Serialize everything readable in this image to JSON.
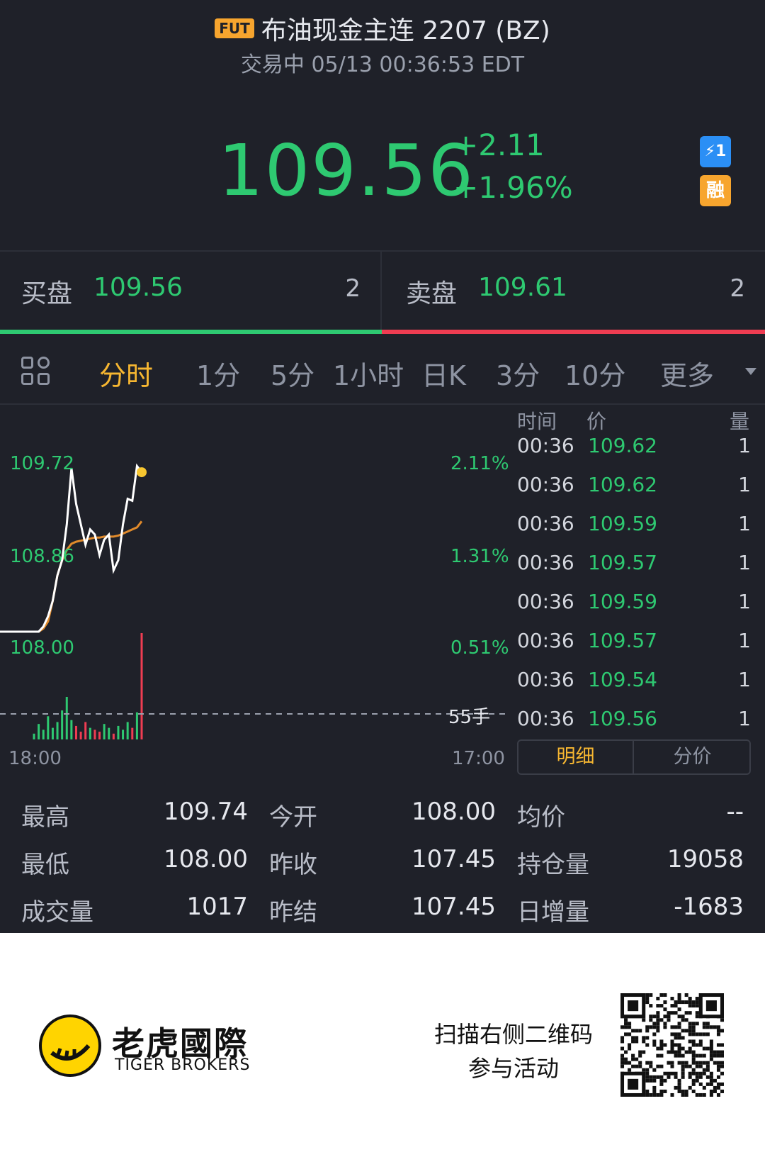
{
  "header": {
    "badge": "FUT",
    "title": "布油现金主连 2207 (BZ)",
    "status": "交易中 05/13 00:36:53 EDT"
  },
  "quote": {
    "last_price": "109.56",
    "change": "+2.11",
    "change_pct": "+1.96%",
    "badge_fast": "⚡1",
    "badge_margin": "融"
  },
  "order_book": {
    "bid_label": "买盘",
    "bid_price": "109.56",
    "bid_size": "2",
    "ask_label": "卖盘",
    "ask_price": "109.61",
    "ask_size": "2"
  },
  "tabs": [
    "分时",
    "1分",
    "5分",
    "1小时",
    "日K",
    "3分",
    "10分",
    "更多"
  ],
  "active_tab": "分时",
  "chart_labels": {
    "price_high": "109.72",
    "price_mid": "108.86",
    "price_low": "108.00",
    "pct_high": "2.11%",
    "pct_mid": "1.31%",
    "pct_low": "0.51%",
    "volume_label": "55手",
    "time_start": "18:00",
    "time_end": "17:00"
  },
  "chart_data": {
    "type": "line",
    "series": [
      {
        "values": [
          108.0,
          108.0,
          108.05,
          108.15,
          108.3,
          108.55,
          108.7,
          109.05,
          109.6,
          109.25,
          109.05,
          108.85,
          109.0,
          108.95,
          108.75,
          108.9,
          108.95,
          108.6,
          108.7,
          109.05,
          109.3,
          109.28,
          109.62,
          109.56
        ]
      },
      {
        "values": [
          108.0,
          108.0,
          108.03,
          108.1,
          108.3,
          108.55,
          108.7,
          108.8,
          108.86,
          108.88,
          108.89,
          108.9,
          108.91,
          108.92,
          108.92,
          108.93,
          108.93,
          108.93,
          108.94,
          108.96,
          108.98,
          109.0,
          109.02,
          109.08
        ]
      }
    ],
    "volume": [
      3,
      8,
      5,
      12,
      6,
      9,
      15,
      22,
      10,
      7,
      4,
      9,
      6,
      5,
      4,
      8,
      6,
      3,
      7,
      5,
      9,
      6,
      14,
      55
    ],
    "ylim": [
      108.0,
      109.72
    ]
  },
  "ticks_header": {
    "time": "时间",
    "price": "价",
    "qty": "量"
  },
  "ticks": [
    {
      "time": "00:36",
      "price": "109.62",
      "qty": "1"
    },
    {
      "time": "00:36",
      "price": "109.62",
      "qty": "1"
    },
    {
      "time": "00:36",
      "price": "109.59",
      "qty": "1"
    },
    {
      "time": "00:36",
      "price": "109.57",
      "qty": "1"
    },
    {
      "time": "00:36",
      "price": "109.59",
      "qty": "1"
    },
    {
      "time": "00:36",
      "price": "109.57",
      "qty": "1"
    },
    {
      "time": "00:36",
      "price": "109.54",
      "qty": "1"
    },
    {
      "time": "00:36",
      "price": "109.56",
      "qty": "1"
    }
  ],
  "ticks_toggle": {
    "detail": "明细",
    "by_price": "分价"
  },
  "stats": {
    "high_label": "最高",
    "high": "109.74",
    "open_label": "今开",
    "open": "108.00",
    "avg_label": "均价",
    "avg": "--",
    "low_label": "最低",
    "low": "108.00",
    "prev_close_label": "昨收",
    "prev_close": "107.45",
    "oi_label": "持仓量",
    "oi": "19058",
    "volume_label": "成交量",
    "volume": "1017",
    "prev_settle_label": "昨结",
    "prev_settle": "107.45",
    "oi_change_label": "日增量",
    "oi_change": "-1683"
  },
  "footer": {
    "brand_cn": "老虎國際",
    "brand_en": "TIGER BROKERS",
    "cta_line1": "扫描右侧二维码",
    "cta_line2": "参与活动"
  }
}
